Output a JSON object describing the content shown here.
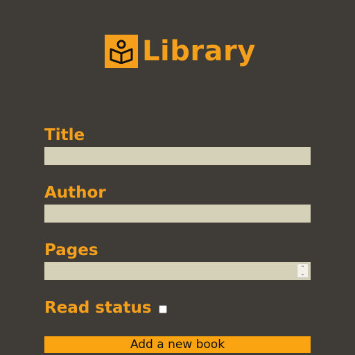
{
  "app": {
    "title": "Library",
    "logo_icon": "book-reader-icon",
    "accent_color": "#f4a01c"
  },
  "form": {
    "title_label": "Title",
    "title_value": "",
    "author_label": "Author",
    "author_value": "",
    "pages_label": "Pages",
    "pages_value": "",
    "read_status_label": "Read status",
    "read_status_checked": false,
    "submit_label": "Add a new book"
  }
}
